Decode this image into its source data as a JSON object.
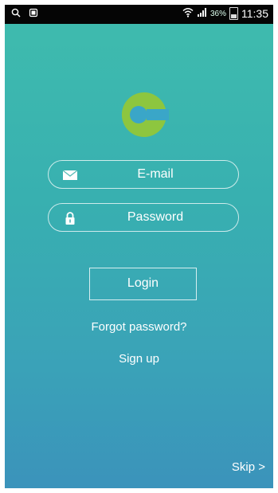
{
  "status": {
    "battery": "36%",
    "time": "11:35",
    "icons": [
      "search-icon",
      "screenshot-icon",
      "wifi-icon",
      "signal-icon",
      "battery-icon"
    ]
  },
  "login": {
    "email_placeholder": "E-mail",
    "password_placeholder": "Password",
    "login_label": "Login",
    "forgot_label": "Forgot password?",
    "signup_label": "Sign up",
    "skip_label": "Skip >"
  },
  "colors": {
    "background_top": "#3fbcae",
    "background_bottom": "#3b93bb",
    "logo_green": "#8dc63f",
    "logo_blue": "#3aa6c8"
  }
}
